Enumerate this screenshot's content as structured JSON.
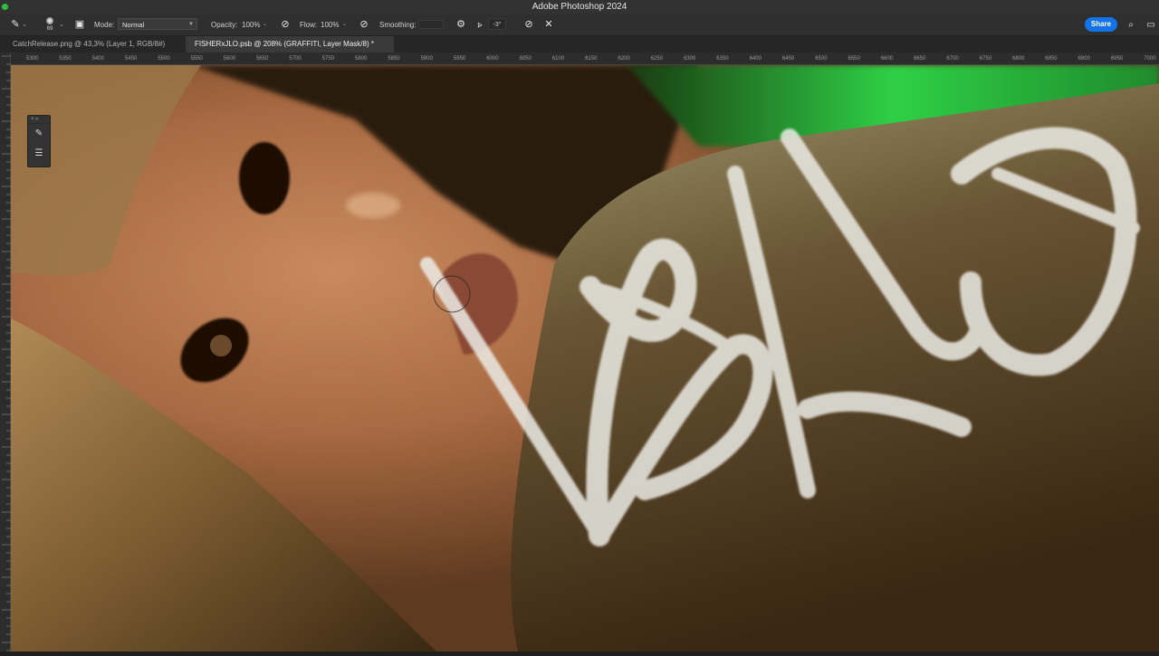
{
  "window": {
    "title": "Adobe Photoshop 2024"
  },
  "options": {
    "brush_size": "69",
    "mode_label": "Mode:",
    "mode_value": "Normal",
    "opacity_label": "Opacity:",
    "opacity_value": "100%",
    "flow_label": "Flow:",
    "flow_value": "100%",
    "smoothing_label": "Smoothing:",
    "angle_value": "-3°",
    "share_label": "Share"
  },
  "tabs": [
    {
      "label": "CatchRelease.png @ 43,3% (Layer 1, RGB/8#)"
    },
    {
      "label": "FISHERxJLO.psb @ 208% (GRAFFITI, Layer Mask/8) *"
    }
  ],
  "ruler": {
    "labels": [
      "5300",
      "5350",
      "5400",
      "5450",
      "5500",
      "5550",
      "5600",
      "5650",
      "5700",
      "5750",
      "5800",
      "5850",
      "5900",
      "5950",
      "6000",
      "6050",
      "6100",
      "6150",
      "6200",
      "6250",
      "6300",
      "6350",
      "6400",
      "6450",
      "6500",
      "6550",
      "6600",
      "6650",
      "6700",
      "6750",
      "6800",
      "6850",
      "6900",
      "6950",
      "7000"
    ]
  },
  "colors": {
    "accent": "#1473e6",
    "graffiti_green": "#2fd046"
  }
}
